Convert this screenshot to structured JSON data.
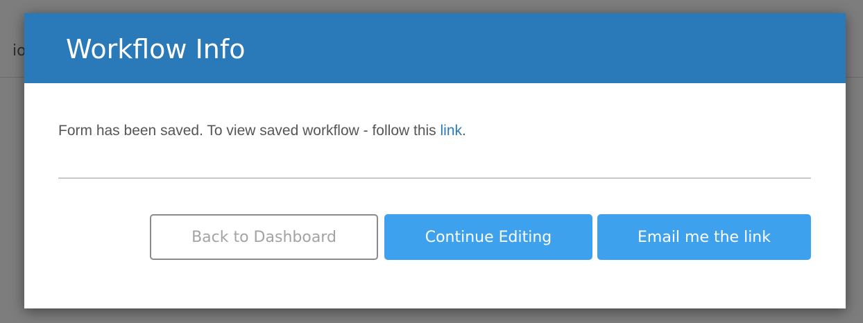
{
  "background": {
    "partial_text": "io"
  },
  "dialog": {
    "title": "Workflow Info",
    "message_text": "Form has been saved. To view saved workflow - follow this ",
    "message_link": "link",
    "message_end": ".",
    "buttons": {
      "back": "Back to Dashboard",
      "continue": "Continue Editing",
      "email": "Email me the link"
    }
  },
  "colors": {
    "header": "#2a79b8",
    "primary_button": "#3ea1ee",
    "link": "#2a79b8",
    "overlay": "#7d7d7d"
  }
}
